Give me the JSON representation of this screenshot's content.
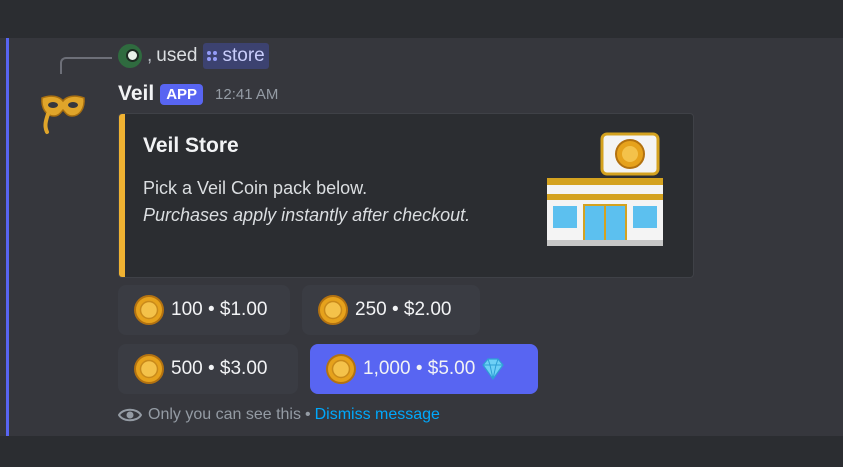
{
  "reply": {
    "separator": ",",
    "username": "used",
    "command": "store"
  },
  "message": {
    "bot_name": "Veil",
    "tag": "APP",
    "timestamp": "12:41 AM"
  },
  "embed": {
    "title": "Veil Store",
    "line1": "Pick a Veil Coin pack below.",
    "line2": "Purchases apply instantly after checkout.",
    "accent_color": "#f0b232",
    "thumbnail_icon": "convenience-store-icon"
  },
  "buttons": [
    {
      "label": "100 • $1.00",
      "icon": "coin-icon",
      "style": "secondary"
    },
    {
      "label": "250 • $2.00",
      "icon": "coin-icon",
      "style": "secondary"
    },
    {
      "label": "500 • $3.00",
      "icon": "coin-icon",
      "style": "secondary"
    },
    {
      "label": "1,000 • $5.00",
      "icon": "coin-icon",
      "trailing_icon": "gem-icon",
      "style": "primary"
    }
  ],
  "footer": {
    "visibility": "Only you can see this",
    "separator": "•",
    "dismiss": "Dismiss message"
  },
  "colors": {
    "blurple": "#5865f2",
    "link": "#00a8fc",
    "background": "#36373d"
  }
}
